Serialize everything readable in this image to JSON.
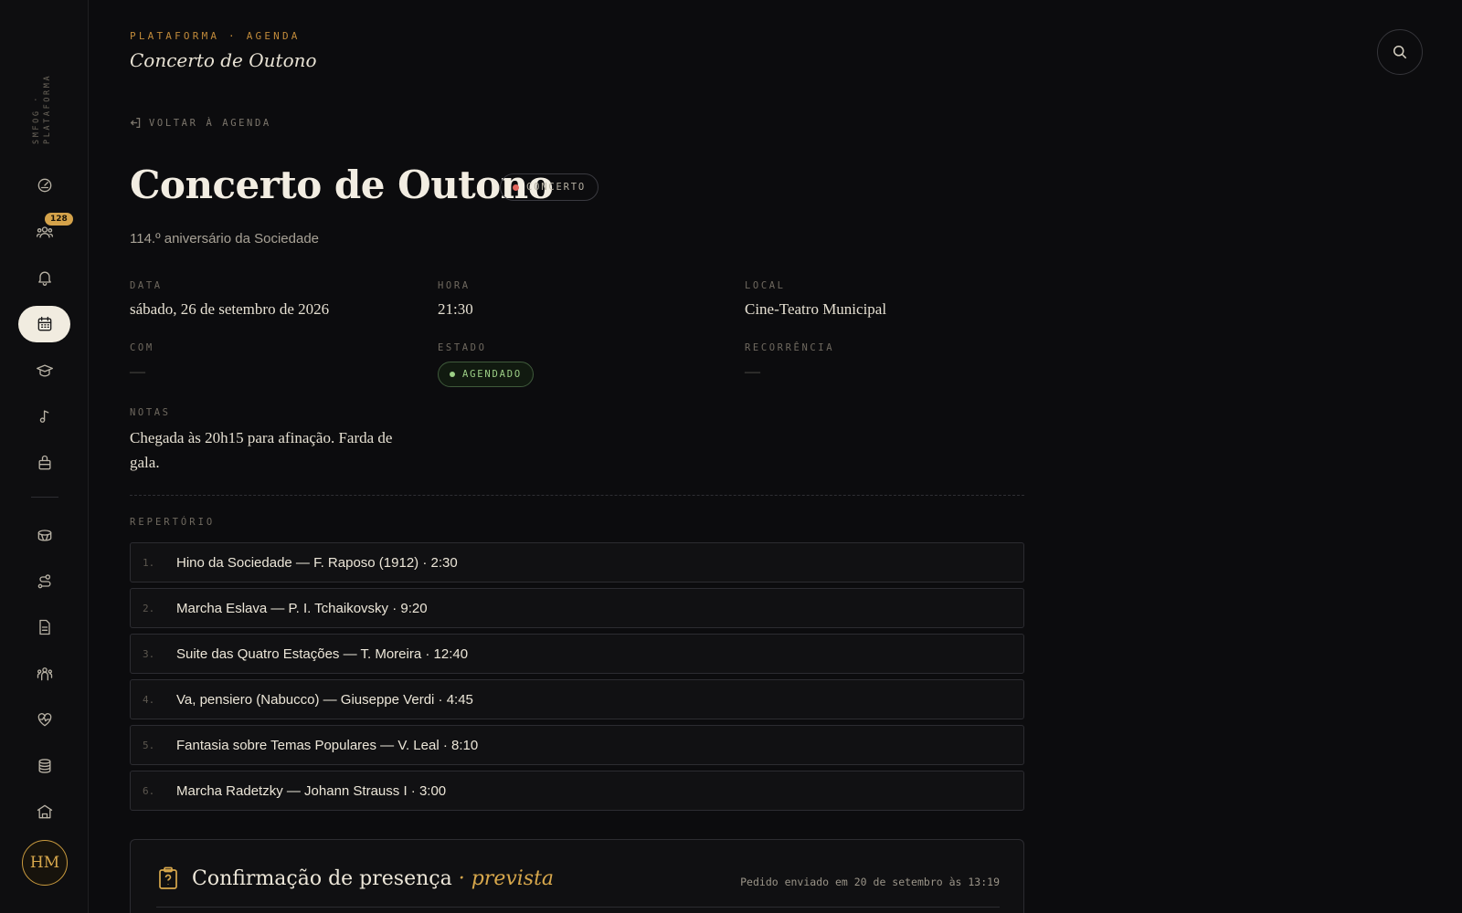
{
  "sidebar": {
    "brand": "SMFOG · PLATAFORMA",
    "notification_count": "128",
    "avatar_initials": "HM",
    "icons": [
      "dashboard-icon",
      "members-icon",
      "bell-icon",
      "calendar-icon",
      "graduation-cap-icon",
      "music-note-icon",
      "instruments-icon",
      "drum-icon",
      "route-icon",
      "document-icon",
      "groups-icon",
      "heart-pulse-icon",
      "coins-icon",
      "building-icon"
    ]
  },
  "header": {
    "breadcrumb": "PLATAFORMA · AGENDA",
    "title": "Concerto de Outono"
  },
  "back_link": "VOLTAR À AGENDA",
  "event": {
    "title": "Concerto de Outono",
    "type_label": "CONCERTO",
    "subtitle": "114.º aniversário da Sociedade",
    "fields": {
      "data_label": "DATA",
      "data_value": "sábado, 26 de setembro de 2026",
      "hora_label": "HORA",
      "hora_value": "21:30",
      "local_label": "LOCAL",
      "local_value": "Cine-Teatro Municipal",
      "com_label": "COM",
      "com_value": "—",
      "estado_label": "ESTADO",
      "estado_value": "AGENDADO",
      "recorrencia_label": "RECORRÊNCIA",
      "recorrencia_value": "—",
      "notas_label": "NOTAS",
      "notas_value": "Chegada às 20h15 para afinação. Farda de gala."
    }
  },
  "repertoire": {
    "label": "REPERTÓRIO",
    "items": [
      {
        "num": "1.",
        "text": "Hino da Sociedade — F. Raposo (1912) · 2:30"
      },
      {
        "num": "2.",
        "text": "Marcha Eslava — P. I. Tchaikovsky · 9:20"
      },
      {
        "num": "3.",
        "text": "Suite das Quatro Estações — T. Moreira · 12:40"
      },
      {
        "num": "4.",
        "text": "Va, pensiero (Nabucco) — Giuseppe Verdi · 4:45"
      },
      {
        "num": "5.",
        "text": "Fantasia sobre Temas Populares — V. Leal · 8:10"
      },
      {
        "num": "6.",
        "text": "Marcha Radetzky — Johann Strauss I · 3:00"
      }
    ]
  },
  "presence": {
    "title": "Confirmação de presença",
    "title_accent": "· prevista",
    "meta": "Pedido enviado em 20 de setembro às 13:19"
  },
  "colors": {
    "accent_gold": "#d8a84c",
    "status_green": "#9ccf86",
    "type_red": "#e0645c",
    "background": "#0c0c0e"
  }
}
